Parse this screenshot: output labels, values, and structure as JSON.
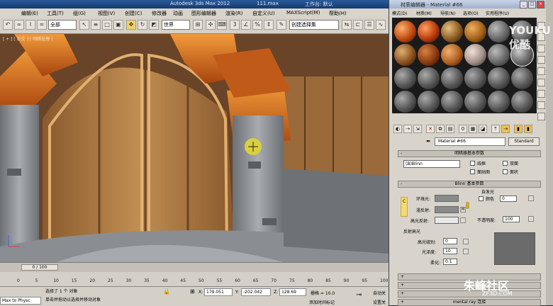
{
  "app": {
    "title": "Autodesk 3ds Max  2012",
    "file": "111.max",
    "workspace": "工作台: 默认"
  },
  "menu": [
    "编辑(E)",
    "工具(T)",
    "组(G)",
    "视图(V)",
    "创建(C)",
    "修改器",
    "动画",
    "图形编辑器",
    "渲染(R)",
    "自定义(U)",
    "MAXScript(M)",
    "帮助(H)"
  ],
  "toolbar": {
    "selection_filter": "全部",
    "ref_coord": "世界",
    "named_selection": "创建选择集",
    "snap_value": "3"
  },
  "viewport": {
    "label": "[ + ] [ 正交 ] [ 明暗处理 ]"
  },
  "material_editor": {
    "title": "材质编辑器 - Material #66",
    "menu": [
      "模式(D)",
      "材质(M)",
      "导航(N)",
      "选项(O)",
      "实用程序(U)"
    ],
    "material_name": "Material #66",
    "material_type": "Standard",
    "shader_rollout": "明暗器基本参数",
    "shader": "(B)Blinn",
    "shader_options": [
      "线框",
      "双面",
      "面贴图",
      "面状"
    ],
    "blinn_rollout": "Blinn 基本参数",
    "self_illum_group": "自发光",
    "color_label": "颜色",
    "self_illum_value": "0",
    "ambient": "环境光:",
    "diffuse": "漫反射:",
    "specular": "高光反射:",
    "lock_letter": "M",
    "c_letter": "C",
    "opacity_label": "不透明度:",
    "opacity": "100",
    "specular_group": "反射高光",
    "spec_level_label": "高光级别:",
    "spec_level": "0",
    "glossiness_label": "光泽度:",
    "glossiness": "10",
    "soften_label": "柔化:",
    "soften": "0.1",
    "bottom_rollout": "mental ray 连接"
  },
  "timeline": {
    "frame": "0 / 100",
    "ticks": [
      "0",
      "5",
      "10",
      "15",
      "20",
      "25",
      "30",
      "35",
      "40",
      "45",
      "50",
      "55",
      "60",
      "65",
      "70",
      "75",
      "80",
      "85",
      "90",
      "95",
      "100"
    ]
  },
  "status": {
    "left_label": "Max to Physc",
    "selected": "选择了 1 个 对象",
    "prompt": "单击并拖动以选择并移动对象",
    "x_label": "X:",
    "x": "179.051",
    "y_label": "Y:",
    "y": "-202.042",
    "z_label": "Z:",
    "z": "128.69",
    "grid": "栅格 = 10.0",
    "autokey": "自动关",
    "add_time_tag": "添加时间标记",
    "set_key": "设置关"
  },
  "watermarks": {
    "youku": "YOUKU",
    "youku_cn": "优酷",
    "zhufeng": "朱峰社区",
    "zhufeng_url": "ZF3D.COM"
  },
  "colors": {
    "wood": "#b98a4e",
    "orange_brick": "#d06a1e",
    "stone": "#8c9094",
    "ambient_swatch": "#8a8a8a",
    "diffuse_swatch": "#8a8a8a",
    "specular_swatch": "#e8e8e8",
    "preview": "#6b6b6b"
  }
}
